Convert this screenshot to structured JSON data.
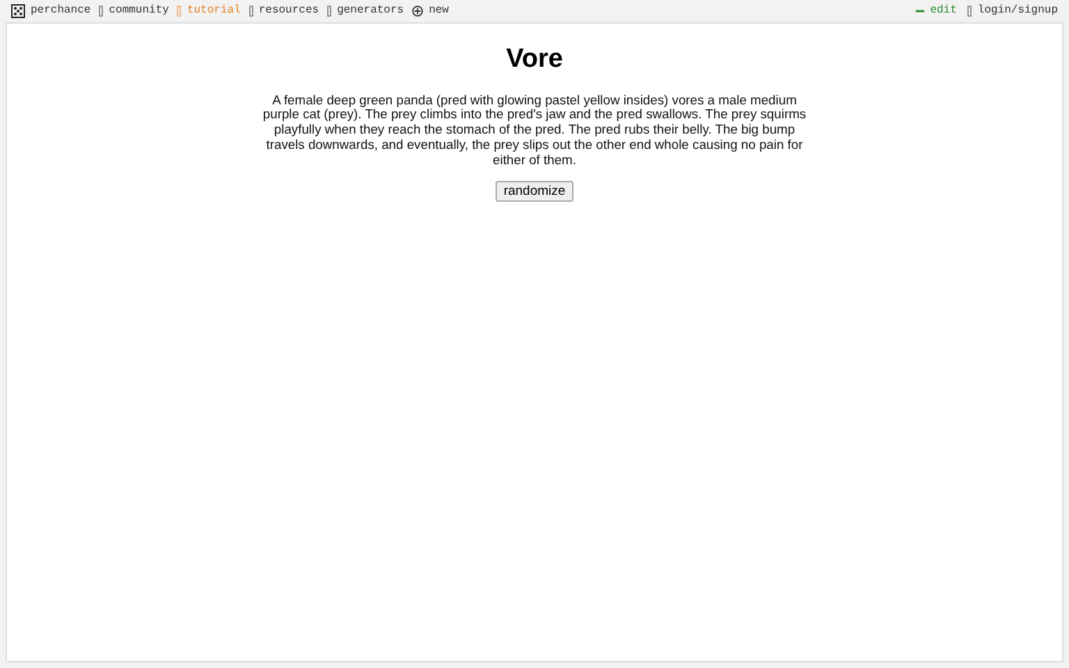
{
  "nav_left": [
    {
      "label": "perchance",
      "kind": "logo",
      "color": "#333333"
    },
    {
      "label": "community",
      "kind": "link",
      "color": "#333333"
    },
    {
      "label": "tutorial",
      "kind": "link",
      "color": "#e67e22"
    },
    {
      "label": "resources",
      "kind": "link",
      "color": "#333333"
    },
    {
      "label": "generators",
      "kind": "link",
      "color": "#333333"
    },
    {
      "label": "new",
      "kind": "new",
      "color": "#333333"
    }
  ],
  "nav_right": [
    {
      "label": "edit",
      "kind": "edit",
      "color": "#2e8b2e"
    },
    {
      "label": "login/signup",
      "kind": "link",
      "color": "#333333"
    }
  ],
  "title": "Vore",
  "output": "A female deep green panda (pred with glowing pastel yellow insides) vores a male medium purple cat (prey). The prey climbs into the pred's jaw and the pred swallows. The prey squirms playfully when they reach the stomach of the pred. The pred rubs their belly. The big bump travels downwards, and eventually, the prey slips out the other end whole causing no pain for either of them.",
  "button": "randomize"
}
